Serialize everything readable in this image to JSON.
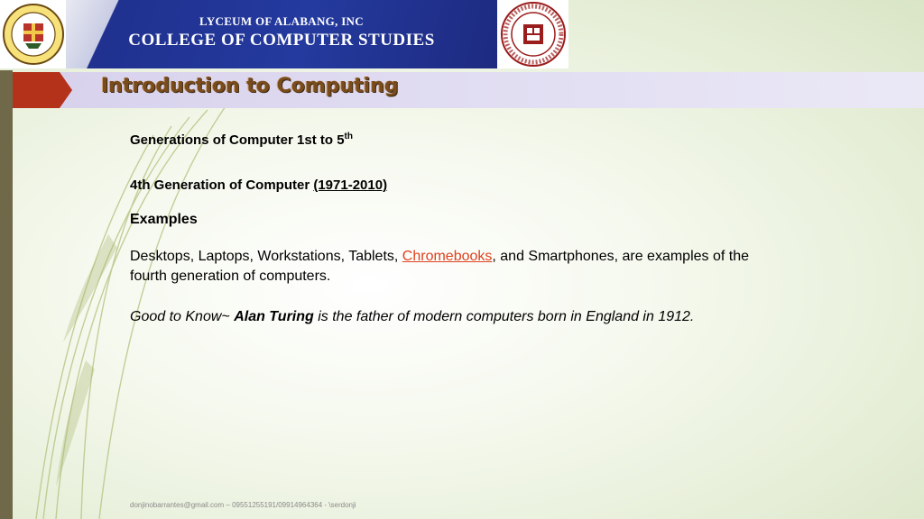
{
  "banner": {
    "line1": "LYCEUM OF ALABANG, INC",
    "line2": "COLLEGE OF COMPUTER STUDIES",
    "brand_blue": "#243a9e",
    "logo_left_text": "LYCEUM of ALABANG",
    "logo_left_year": "2003",
    "logo_right_text_top": "COLLEGE OF COMPUTER STUDIES",
    "logo_right_text_bottom": "LYCEUM OF ALABANG"
  },
  "title": {
    "text": "Introduction to Computing",
    "color": "#7a4b1c",
    "arrow_color": "#b4321a"
  },
  "content": {
    "generations_heading_main": "Generations of Computer 1st to 5",
    "generations_heading_sup": "th",
    "fourth_heading_main": "4th Generation of Computer ",
    "fourth_heading_years": "(1971-2010)",
    "examples_heading": "Examples",
    "desc_before_link": "Desktops, Laptops, Workstations, Tablets, ",
    "desc_link": "Chromebooks",
    "desc_after_link": ", and Smartphones, are examples of the fourth generation of computers.",
    "know_prefix": "Good to Know~ ",
    "know_name": "Alan Turing",
    "know_suffix": " is the father of modern computers born in England in 1912."
  },
  "footer": {
    "text": "donjinobarrantes@gmail.com – 09551255191/09914964364 - \\serdonji"
  }
}
